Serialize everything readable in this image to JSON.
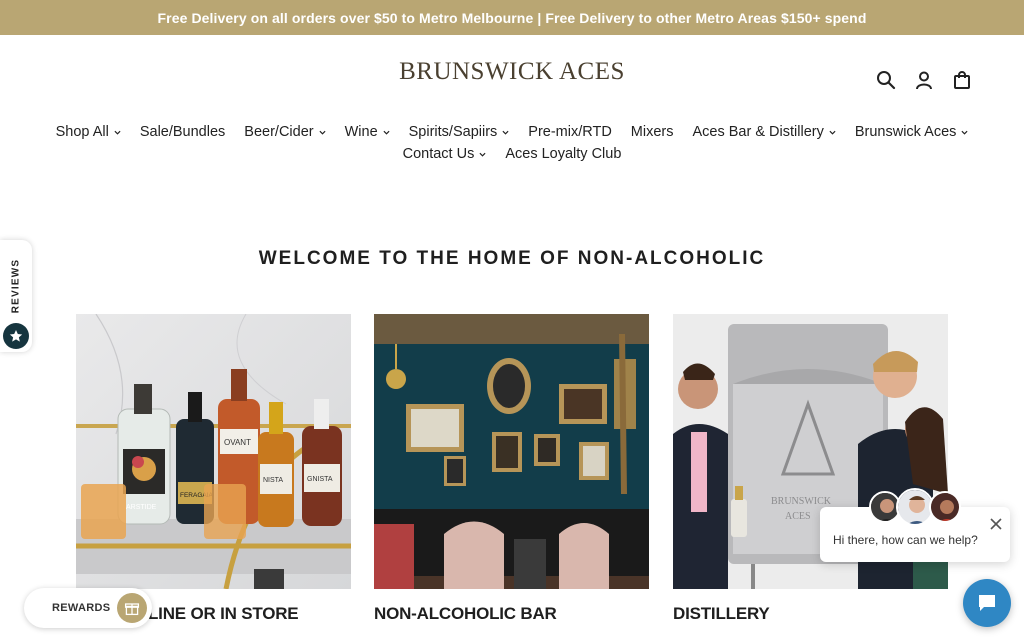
{
  "announcement": "Free Delivery on all orders over $50 to Metro Melbourne | Free Delivery to other Metro Areas $150+ spend",
  "brand": "BRUNSWICK ACES",
  "header_icons": [
    "search-icon",
    "account-icon",
    "cart-icon"
  ],
  "nav": {
    "row1": [
      {
        "label": "Shop All",
        "dropdown": true
      },
      {
        "label": "Sale/Bundles",
        "dropdown": false
      },
      {
        "label": "Beer/Cider",
        "dropdown": true
      },
      {
        "label": "Wine",
        "dropdown": true
      },
      {
        "label": "Spirits/Sapiirs",
        "dropdown": true
      },
      {
        "label": "Pre-mix/RTD",
        "dropdown": false
      },
      {
        "label": "Mixers",
        "dropdown": false
      },
      {
        "label": "Aces Bar & Distillery",
        "dropdown": true
      },
      {
        "label": "Brunswick Aces",
        "dropdown": true
      }
    ],
    "row2": [
      {
        "label": "Contact Us",
        "dropdown": true
      },
      {
        "label": "Aces Loyalty Club",
        "dropdown": false
      }
    ]
  },
  "welcome_heading": "WELCOME TO THE HOME OF NON-ALCOHOLIC",
  "cards": [
    {
      "title": "LINE OR IN STORE"
    },
    {
      "title": "NON-ALCOHOLIC BAR"
    },
    {
      "title": "DISTILLERY"
    }
  ],
  "bottle_labels": {
    "b1": "ARSTIDE",
    "b2": "FERAGAIA",
    "b3": "OVANT",
    "b4": "NISTA",
    "b5": "GNISTA"
  },
  "reviews_tab": "REVIEWS",
  "rewards_label": "REWARDS",
  "chat": {
    "greeting": "Hi there, how can we help?"
  },
  "colors": {
    "announcement_bg": "#b9a673",
    "chat_launcher": "#2f87c4",
    "reviews_badge": "#16353f"
  }
}
